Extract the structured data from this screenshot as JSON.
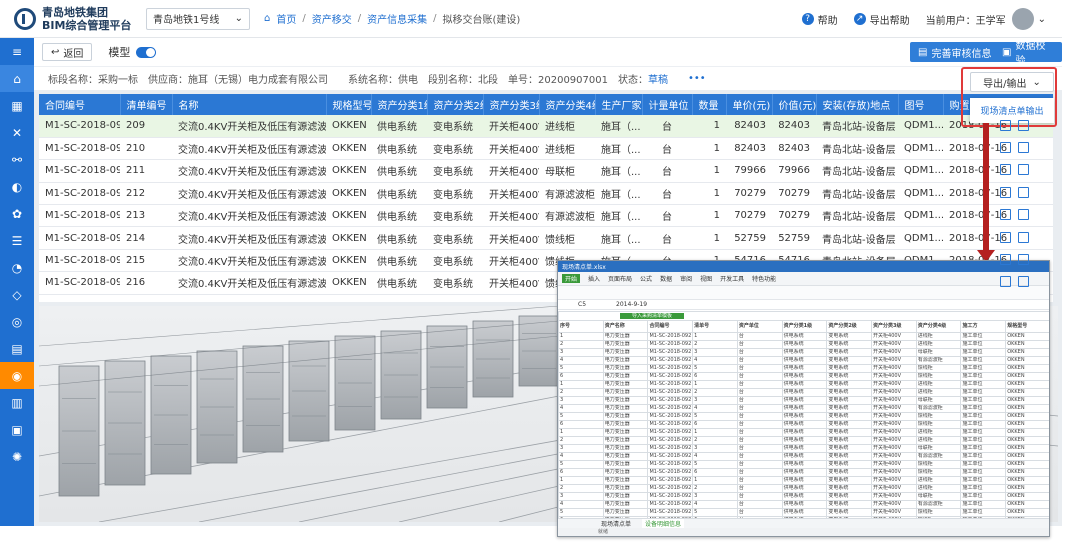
{
  "header": {
    "company": "青岛地铁集团",
    "platform": "BIM综合管理平台",
    "line_select": "青岛地铁1号线",
    "breadcrumbs": [
      "首页",
      "资产移交",
      "资产信息采集",
      "拟移交台账(建设)"
    ],
    "help": "帮助",
    "export_help": "导出帮助",
    "current_user": "当前用户：王学军"
  },
  "toolbar": {
    "back": "返回",
    "model_label": "模型",
    "btn_review": "完善审核信息",
    "btn_check": "数据校验"
  },
  "info_bar": {
    "section": "标段名称：采购一标",
    "supplier": "供应商：",
    "supplier_name": "施耳（无锡）电力成套有限公司",
    "system": "系统名称：供电",
    "segment": "段别名称：北段",
    "order_no": "单号：20200907001",
    "status_label": "状态：",
    "status_value": "草稿",
    "more": "•••"
  },
  "export": {
    "button": "导出/输出",
    "menu_item": "现场清点单输出"
  },
  "table": {
    "columns": [
      "合同编号",
      "清单编号",
      "名称",
      "规格型号",
      "资产分类1级",
      "资产分类2级",
      "资产分类3级",
      "资产分类4级",
      "生产厂家",
      "计量单位",
      "数量",
      "单价(元)",
      "价值(元)",
      "安装(存放)地点",
      "图号",
      "购置日期"
    ],
    "rows": [
      [
        "M1-SC-2018-092",
        "209",
        "交流0.4KV开关柜及低压有源滤波装置",
        "OKKEN",
        "供电系统",
        "变电系统",
        "开关柜400V",
        "进线柜",
        "施耳（...",
        "台",
        "1",
        "82403",
        "82403",
        "青岛北站-设备层",
        "QDM1...",
        "2018-07-16"
      ],
      [
        "M1-SC-2018-092",
        "210",
        "交流0.4KV开关柜及低压有源滤波装置",
        "OKKEN",
        "供电系统",
        "变电系统",
        "开关柜400V",
        "进线柜",
        "施耳（...",
        "台",
        "1",
        "82403",
        "82403",
        "青岛北站-设备层",
        "QDM1...",
        "2018-07-16"
      ],
      [
        "M1-SC-2018-092",
        "211",
        "交流0.4KV开关柜及低压有源滤波装置",
        "OKKEN",
        "供电系统",
        "变电系统",
        "开关柜400V",
        "母联柜",
        "施耳（...",
        "台",
        "1",
        "79966",
        "79966",
        "青岛北站-设备层",
        "QDM1...",
        "2018-07-16"
      ],
      [
        "M1-SC-2018-092",
        "212",
        "交流0.4KV开关柜及低压有源滤波装置",
        "OKKEN",
        "供电系统",
        "变电系统",
        "开关柜400V",
        "有源滤波柜",
        "施耳（...",
        "台",
        "1",
        "70279",
        "70279",
        "青岛北站-设备层",
        "QDM1...",
        "2018-07-16"
      ],
      [
        "M1-SC-2018-092",
        "213",
        "交流0.4KV开关柜及低压有源滤波装置",
        "OKKEN",
        "供电系统",
        "变电系统",
        "开关柜400V",
        "有源滤波柜",
        "施耳（...",
        "台",
        "1",
        "70279",
        "70279",
        "青岛北站-设备层",
        "QDM1...",
        "2018-07-16"
      ],
      [
        "M1-SC-2018-092",
        "214",
        "交流0.4KV开关柜及低压有源滤波装置",
        "OKKEN",
        "供电系统",
        "变电系统",
        "开关柜400V",
        "馈线柜",
        "施耳（...",
        "台",
        "1",
        "52759",
        "52759",
        "青岛北站-设备层",
        "QDM1...",
        "2018-07-16"
      ],
      [
        "M1-SC-2018-092",
        "215",
        "交流0.4KV开关柜及低压有源滤波装置",
        "OKKEN",
        "供电系统",
        "变电系统",
        "开关柜400V",
        "馈线柜",
        "施耳（...",
        "台",
        "1",
        "54716",
        "54716",
        "青岛北站-设备层",
        "QDM1...",
        "2018-07-16"
      ],
      [
        "M1-SC-2018-092",
        "216",
        "交流0.4KV开关柜及低压有源滤波装置",
        "OKKEN",
        "供电系统",
        "变电系统",
        "开关柜400V",
        "馈线柜",
        "施耳（...",
        "台",
        "1",
        "52759",
        "52759",
        "青岛北站-设备层",
        "QDM1...",
        "2018-07-16"
      ]
    ]
  },
  "sidebar": {
    "icons": [
      "menu-icon",
      "home-icon",
      "layers-icon",
      "tools-icon",
      "flow-icon",
      "asset-icon",
      "gear-icon",
      "sliders-icon",
      "pie-icon",
      "shield-icon",
      "target-icon",
      "doc-icon",
      "globe-icon",
      "chart-icon",
      "image-icon",
      "settings-icon"
    ]
  },
  "spreadsheet": {
    "title": "现场清点单.xlsx",
    "ribbon_tabs": [
      "开始",
      "插入",
      "页面布局",
      "公式",
      "数据",
      "审阅",
      "视图",
      "开发工具",
      "特色功能"
    ],
    "cell_ref": "C5",
    "formula": "2014-9-19",
    "banner": "导入采购清单模板",
    "header_row": [
      "序号",
      "资产名称",
      "合同编号",
      "清单号",
      "资产单位",
      "资产分类1级",
      "资产分类2级",
      "资产分类3级",
      "资产分类4级",
      "施工方",
      "规格型号"
    ],
    "rows": [
      [
        "1",
        "电力变压器",
        "M1-SC-2018-092",
        "1",
        "台",
        "供电系统",
        "变电系统",
        "开关柜400V",
        "进线柜",
        "施工单位",
        "OKKEN"
      ],
      [
        "2",
        "电力变压器",
        "M1-SC-2018-092",
        "2",
        "台",
        "供电系统",
        "变电系统",
        "开关柜400V",
        "进线柜",
        "施工单位",
        "OKKEN"
      ],
      [
        "3",
        "电力变压器",
        "M1-SC-2018-092",
        "3",
        "台",
        "供电系统",
        "变电系统",
        "开关柜400V",
        "母联柜",
        "施工单位",
        "OKKEN"
      ],
      [
        "4",
        "电力变压器",
        "M1-SC-2018-092",
        "4",
        "台",
        "供电系统",
        "变电系统",
        "开关柜400V",
        "有源滤波柜",
        "施工单位",
        "OKKEN"
      ],
      [
        "5",
        "电力变压器",
        "M1-SC-2018-092",
        "5",
        "台",
        "供电系统",
        "变电系统",
        "开关柜400V",
        "馈线柜",
        "施工单位",
        "OKKEN"
      ],
      [
        "6",
        "电力变压器",
        "M1-SC-2018-092",
        "6",
        "台",
        "供电系统",
        "变电系统",
        "开关柜400V",
        "馈线柜",
        "施工单位",
        "OKKEN"
      ]
    ],
    "sheet_tabs": [
      "现场清点单",
      "设备明细信息"
    ],
    "status": "就绪"
  }
}
